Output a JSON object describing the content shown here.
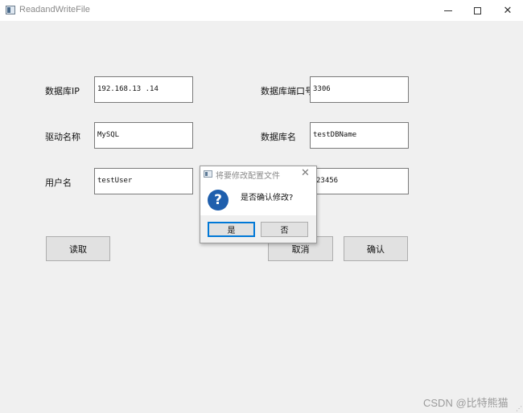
{
  "window": {
    "title": "ReadandWriteFile",
    "close_glyph": "✕"
  },
  "form": {
    "db_ip": {
      "label": "数据库IP",
      "value": "192.168.13 .14"
    },
    "db_port": {
      "label": "数据库端口号",
      "value": "3306"
    },
    "driver": {
      "label": "驱动名称",
      "value": "MySQL"
    },
    "db_name": {
      "label": "数据库名",
      "value": "testDBName"
    },
    "user": {
      "label": "用户名",
      "value": "testUser"
    },
    "password": {
      "label": "",
      "value": "23456"
    }
  },
  "buttons": {
    "read": "读取",
    "cancel": "取消",
    "confirm": "确认"
  },
  "dialog": {
    "title": "将要修改配置文件",
    "message": "是否确认修改?",
    "yes": "是",
    "no": "否",
    "icon_glyph": "?",
    "close_glyph": "✕"
  },
  "watermark": "CSDN @比特熊猫",
  "icons": [
    "app-icon",
    "minimize-icon",
    "maximize-icon",
    "close-icon",
    "question-icon",
    "resize-grip-icon"
  ],
  "colors": {
    "background": "#f0f0f0",
    "question_icon": "#1f5fad",
    "default_button_border": "#0078d7"
  }
}
